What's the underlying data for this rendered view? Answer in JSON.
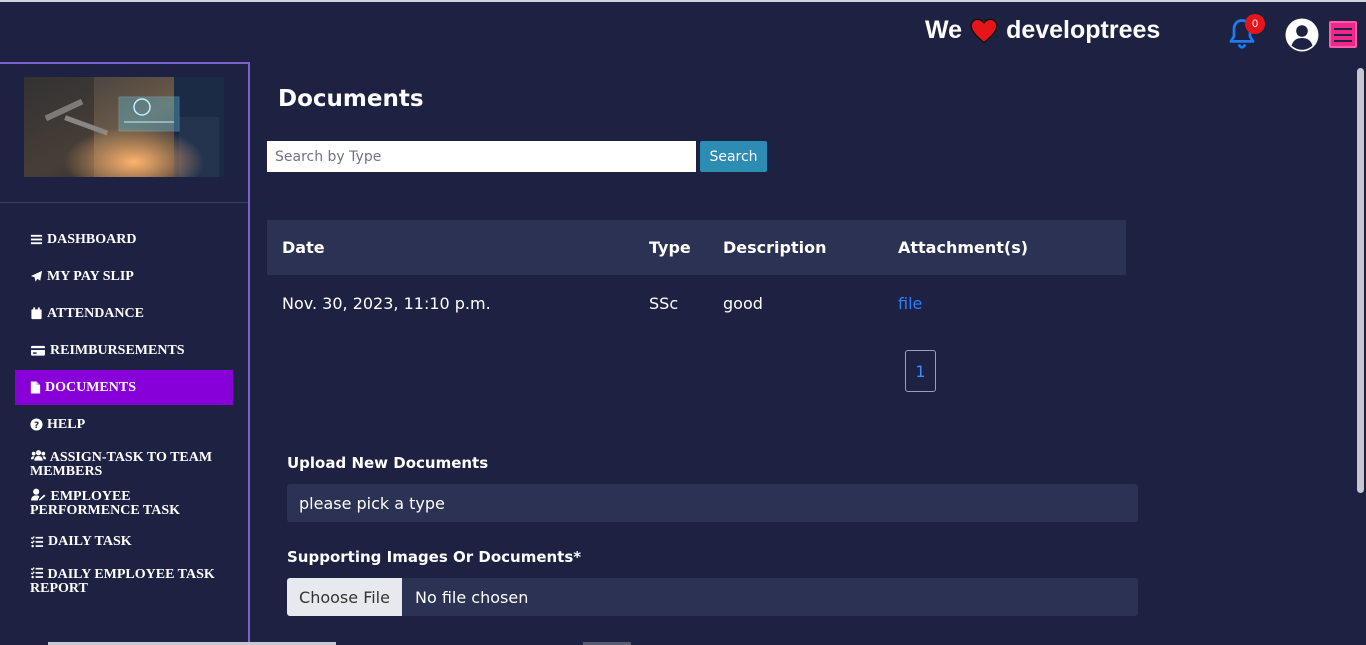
{
  "header": {
    "brand_pre": "We",
    "brand_post": "developtrees",
    "notification_count": "0"
  },
  "sidebar": {
    "items": [
      {
        "label": "DASHBOARD",
        "icon": "bars-icon"
      },
      {
        "label": "MY PAY SLIP",
        "icon": "paper-plane-icon"
      },
      {
        "label": "ATTENDANCE",
        "icon": "calendar-icon"
      },
      {
        "label": "REIMBURSEMENTS",
        "icon": "credit-card-icon"
      },
      {
        "label": "DOCUMENTS",
        "icon": "file-icon",
        "active": true
      },
      {
        "label": "HELP",
        "icon": "question-circle-icon"
      },
      {
        "label": "ASSIGN-TASK TO TEAM MEMBERS",
        "icon": "users-icon"
      },
      {
        "label": "EMPLOYEE PERFORMENCE TASK",
        "icon": "user-edit-icon"
      },
      {
        "label": "DAILY TASK",
        "icon": "list-check-icon"
      },
      {
        "label": "DAILY EMPLOYEE TASK REPORT",
        "icon": "list-check-icon"
      }
    ]
  },
  "main": {
    "title": "Documents",
    "search_placeholder": "Search by Type",
    "search_button": "Search",
    "table": {
      "headers": [
        "Date",
        "Type",
        "Description",
        "Attachment(s)"
      ],
      "rows": [
        {
          "date": "Nov. 30, 2023, 11:10 p.m.",
          "type": "SSc",
          "description": "good",
          "attachment": "file"
        }
      ]
    },
    "pagination": {
      "current_page": "1"
    },
    "upload": {
      "label": "Upload New Documents",
      "type_select_value": "please pick a type",
      "support_label": "Supporting Images Or Documents*",
      "choose_file_label": "Choose File",
      "no_file_text": "No file chosen"
    }
  },
  "colors": {
    "background": "#1d2243",
    "accent_active": "#8800d8",
    "link": "#2f7dff",
    "search_button": "#2d8cb4",
    "menu_button": "#f0278a"
  }
}
